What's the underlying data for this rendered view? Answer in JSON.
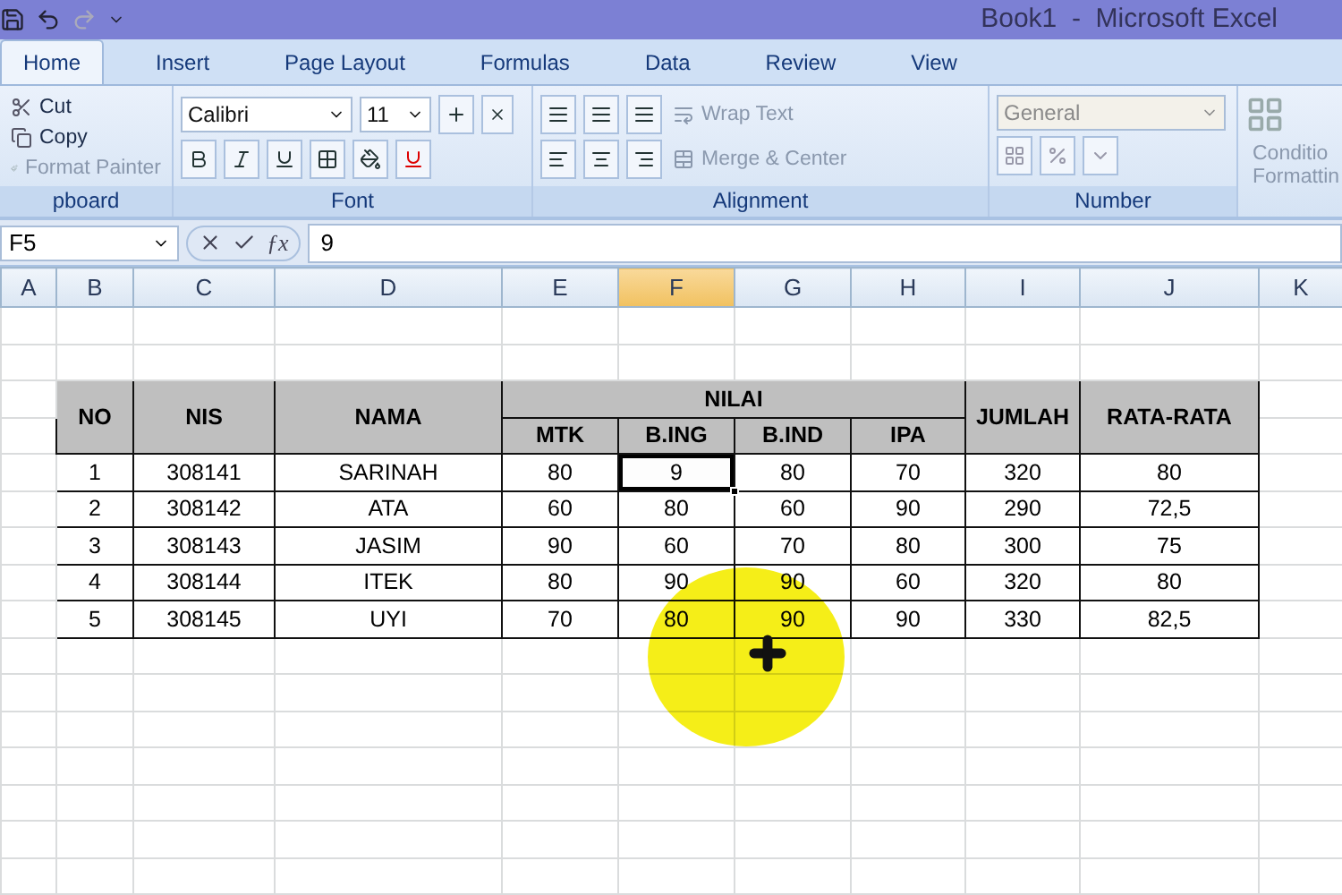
{
  "window": {
    "title": "Book1  -  Microsoft Excel"
  },
  "tabs": [
    {
      "label": "Home",
      "selected": true
    },
    {
      "label": "Insert",
      "selected": false
    },
    {
      "label": "Page Layout",
      "selected": false
    },
    {
      "label": "Formulas",
      "selected": false
    },
    {
      "label": "Data",
      "selected": false
    },
    {
      "label": "Review",
      "selected": false
    },
    {
      "label": "View",
      "selected": false
    }
  ],
  "ribbon": {
    "clipboard": {
      "label": "pboard",
      "items": [
        {
          "label": "Cut",
          "disabled": false
        },
        {
          "label": "Copy",
          "disabled": false
        },
        {
          "label": "Format Painter",
          "disabled": true
        }
      ]
    },
    "font": {
      "label": "Font",
      "font_name": "Calibri",
      "font_size": "11"
    },
    "alignment": {
      "label": "Alignment",
      "items": [
        {
          "label": "Wrap Text",
          "disabled": true
        },
        {
          "label": "Merge & Center",
          "disabled": true
        }
      ]
    },
    "number": {
      "label": "Number",
      "format": "General"
    },
    "styles": {
      "lines": [
        "Conditio",
        "Formattin"
      ]
    }
  },
  "formula_bar": {
    "name_box": "F5",
    "function_label": "ƒx",
    "value": "9"
  },
  "columns": [
    {
      "label": "A",
      "selected": false
    },
    {
      "label": "B",
      "selected": false
    },
    {
      "label": "C",
      "selected": false
    },
    {
      "label": "D",
      "selected": false
    },
    {
      "label": "E",
      "selected": false
    },
    {
      "label": "F",
      "selected": true
    },
    {
      "label": "G",
      "selected": false
    },
    {
      "label": "H",
      "selected": false
    },
    {
      "label": "I",
      "selected": false
    },
    {
      "label": "J",
      "selected": false
    },
    {
      "label": "K",
      "selected": false
    }
  ],
  "table": {
    "headers": {
      "no": "NO",
      "nis": "NIS",
      "nama": "NAMA",
      "nilai": "NILAI",
      "subjects": [
        "MTK",
        "B.ING",
        "B.IND",
        "IPA"
      ],
      "jumlah": "JUMLAH",
      "rata": "RATA-RATA"
    },
    "rows": [
      {
        "no": "1",
        "nis": "308141",
        "nama": "SARINAH",
        "scores": [
          {
            "text": "80",
            "selected": false
          },
          {
            "text": "9",
            "selected": true
          },
          {
            "text": "80",
            "selected": false
          },
          {
            "text": "70",
            "selected": false
          }
        ],
        "jumlah": "320",
        "rata": "80"
      },
      {
        "no": "2",
        "nis": "308142",
        "nama": "ATA",
        "scores": [
          {
            "text": "60",
            "selected": false
          },
          {
            "text": "80",
            "selected": false
          },
          {
            "text": "60",
            "selected": false
          },
          {
            "text": "90",
            "selected": false
          }
        ],
        "jumlah": "290",
        "rata": "72,5"
      },
      {
        "no": "3",
        "nis": "308143",
        "nama": "JASIM",
        "scores": [
          {
            "text": "90",
            "selected": false
          },
          {
            "text": "60",
            "selected": false
          },
          {
            "text": "70",
            "selected": false
          },
          {
            "text": "80",
            "selected": false
          }
        ],
        "jumlah": "300",
        "rata": "75"
      },
      {
        "no": "4",
        "nis": "308144",
        "nama": "ITEK",
        "scores": [
          {
            "text": "80",
            "selected": false
          },
          {
            "text": "90",
            "selected": false
          },
          {
            "text": "90",
            "selected": false
          },
          {
            "text": "60",
            "selected": false
          }
        ],
        "jumlah": "320",
        "rata": "80"
      },
      {
        "no": "5",
        "nis": "308145",
        "nama": "UYI",
        "scores": [
          {
            "text": "70",
            "selected": false
          },
          {
            "text": "80",
            "selected": false
          },
          {
            "text": "90",
            "selected": false
          },
          {
            "text": "90",
            "selected": false
          }
        ],
        "jumlah": "330",
        "rata": "82,5"
      }
    ]
  }
}
